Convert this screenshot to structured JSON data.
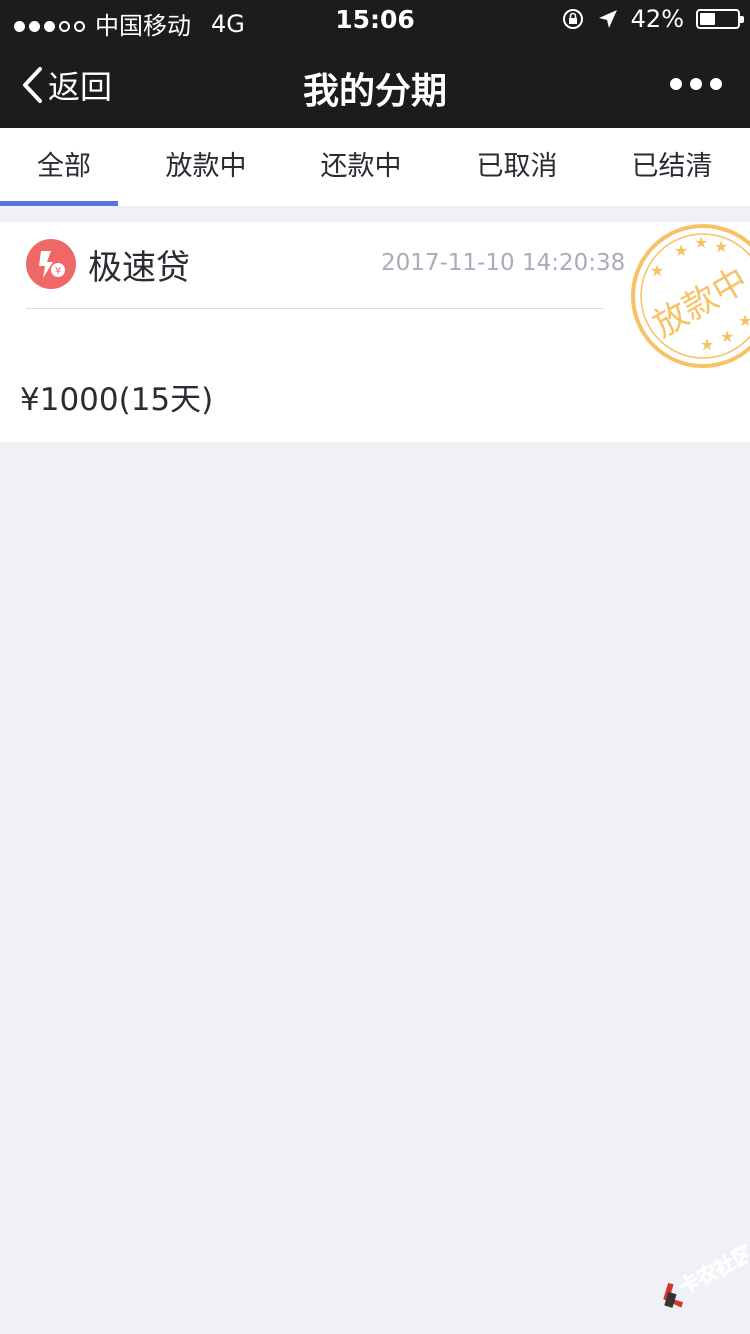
{
  "status_bar": {
    "carrier": "中国移动",
    "network": "4G",
    "time": "15:06",
    "battery_percent": "42%",
    "battery_level": 0.42
  },
  "nav": {
    "back_label": "返回",
    "title": "我的分期"
  },
  "tabs": [
    {
      "label": "全部",
      "active": true
    },
    {
      "label": "放款中",
      "active": false
    },
    {
      "label": "还款中",
      "active": false
    },
    {
      "label": "已取消",
      "active": false
    },
    {
      "label": "已结清",
      "active": false
    }
  ],
  "loan": {
    "name": "极速贷",
    "timestamp": "2017-11-10 14:20:38",
    "amount": "¥1000(15天)",
    "status_stamp": "放款中",
    "icon_color": "#f06767",
    "stamp_color": "#f7c266"
  },
  "watermark": {
    "text": "卡农社区"
  },
  "colors": {
    "accent": "#5a74d8",
    "header_bg": "#1c1c1e",
    "page_bg": "#f0f1f6"
  }
}
